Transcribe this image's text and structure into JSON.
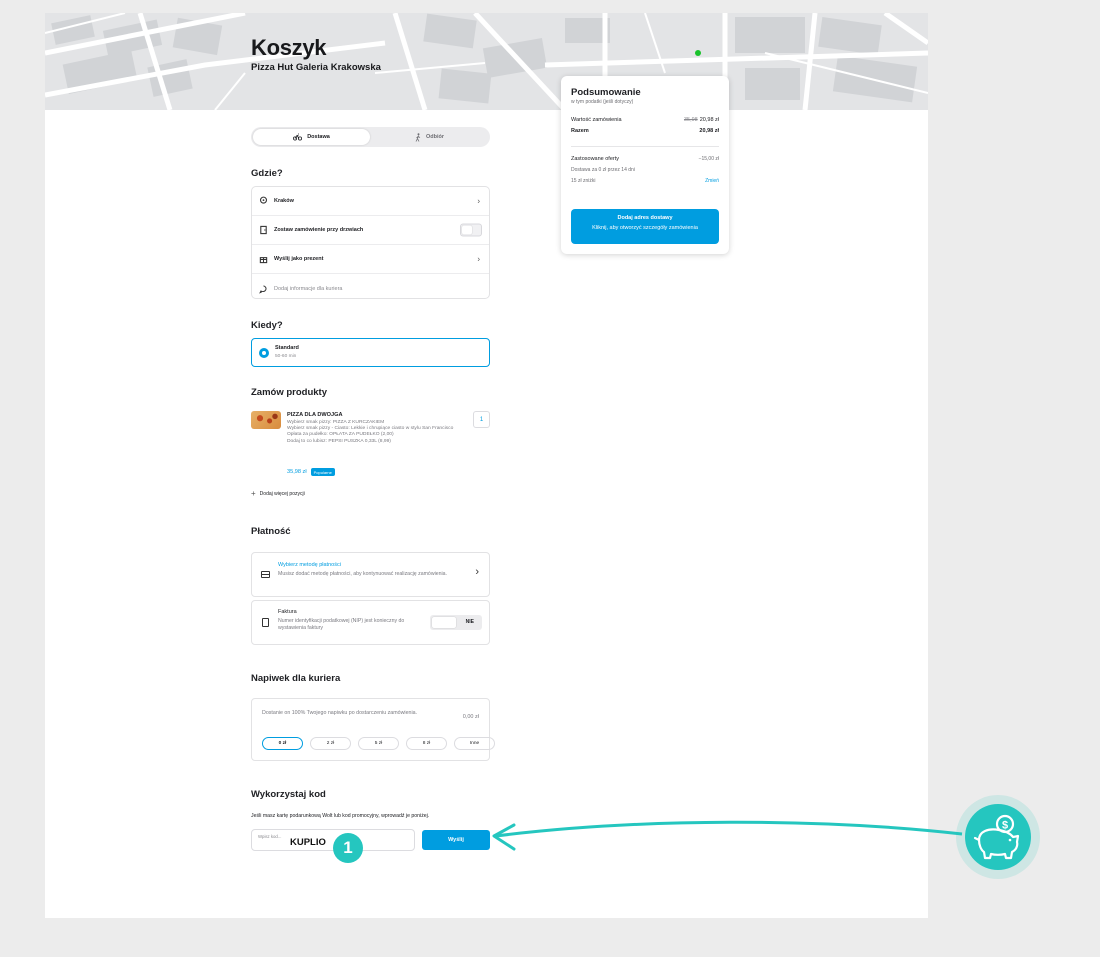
{
  "header": {
    "title": "Koszyk",
    "subtitle": "Pizza Hut Galeria Krakowska"
  },
  "delivery_toggle": {
    "delivery_label": "Dostawa",
    "pickup_label": "Odbiór",
    "selected": "Dostawa"
  },
  "where": {
    "heading": "Gdzie?",
    "items": [
      {
        "label": "Kraków",
        "icon": "location-pin-icon",
        "control": "chevron"
      },
      {
        "label": "Zostaw zamówienie przy drzwiach",
        "icon": "door-icon",
        "control": "switch"
      },
      {
        "label": "Wyślij jako prezent",
        "icon": "gift-icon",
        "control": "chevron"
      },
      {
        "label": "Dodaj informacje dla kuriera",
        "icon": "chat-bubble-icon",
        "control": "none"
      }
    ]
  },
  "when": {
    "heading": "Kiedy?",
    "option_title": "Standard",
    "option_sub": "50-60 min"
  },
  "products": {
    "heading": "Zamów produkty",
    "item": {
      "name": "PIZZA DLA DWOJGA",
      "details": [
        "Wybierz smak pizzy: PIZZA Z KURCZAKIEM",
        "Wybierz smak pizzy - Ciasto: Lekkie i chrupiące ciasto w stylu San Francisco",
        "Opłata za pudełko: OPŁATA ZA PUDEŁKO (2,00)",
        "Dodaj to co lubisz: PEPSI PUSZKA 0,33L (8,99)"
      ],
      "price": "35,98 zł",
      "badge": "Popularne",
      "quantity": "1"
    },
    "add_more": "Dodaj więcej pozycji"
  },
  "payment": {
    "heading": "Płatność",
    "method_title": "Wybierz metodę płatności",
    "method_desc": "Musisz dodać metodę płatności, aby kontynuować realizację zamówienia.",
    "invoice_title": "Faktura",
    "invoice_desc": "Numer identyfikacji podatkowej (NIP) jest konieczny do wystawienia faktury",
    "invoice_toggle": "NIE"
  },
  "tip": {
    "heading": "Napiwek dla kuriera",
    "desc": "Dostanie on 100% Twojego napiwku po dostarczeniu zamówienia.",
    "amount": "0,00 zł",
    "options": [
      "0 zł",
      "2 zł",
      "5 zł",
      "8 zł",
      "Inne"
    ],
    "selected": "0 zł"
  },
  "code": {
    "heading": "Wykorzystaj kod",
    "desc": "Jeśli masz kartę podarunkową Wolt lub kod promocyjny, wprowadź je poniżej.",
    "placeholder": "Wpisz kod...",
    "value": "KUPLIO",
    "button": "Wyślij"
  },
  "summary": {
    "title": "Podsumowanie",
    "subtitle": "w tym podatki (jeśli dotyczy)",
    "order_value_label": "Wartość zamówienia",
    "order_value_old": "35,98",
    "order_value": "20,98 zł",
    "total_label": "Razem",
    "total": "20,98 zł",
    "offers_label": "Zastosowane oferty",
    "offers_value": "−15,00 zł",
    "offer_1": "Dostawa za 0 zł przez 14 dni",
    "offer_2": "15 zł zniżki",
    "change_link": "Zmień",
    "button_line1": "Dodaj adres dostawy",
    "button_line2": "Kliknij, aby otworzyć szczegóły zamówienia"
  },
  "annotation": {
    "step_number": "1",
    "accent_color": "#25c6bf",
    "icon": "piggy-bank-coin-icon"
  },
  "colors": {
    "accent": "#009de0",
    "background": "#ececec",
    "map": "#e4e5e7"
  }
}
